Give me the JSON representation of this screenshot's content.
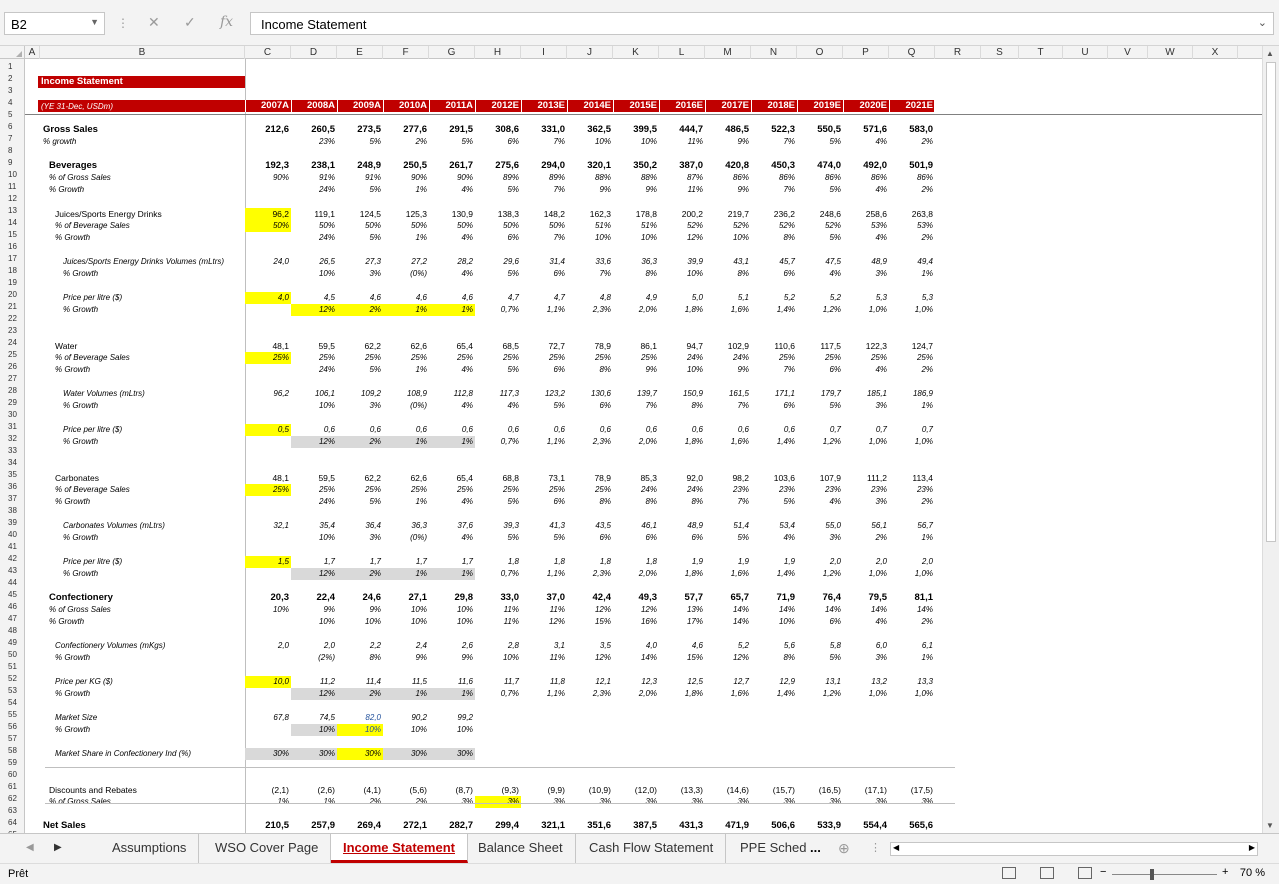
{
  "namebox": "B2",
  "formula": "Income Statement",
  "columns": [
    "A",
    "B",
    "C",
    "D",
    "E",
    "F",
    "G",
    "H",
    "I",
    "J",
    "K",
    "L",
    "M",
    "N",
    "O",
    "P",
    "Q",
    "R",
    "S",
    "T",
    "U",
    "V",
    "W",
    "X"
  ],
  "title": "Income Statement",
  "subtitle": "(YE 31-Dec, USDm)",
  "years": [
    "2007A",
    "2008A",
    "2009A",
    "2010A",
    "2011A",
    "2012E",
    "2013E",
    "2014E",
    "2015E",
    "2016E",
    "2017E",
    "2018E",
    "2019E",
    "2020E",
    "2021E"
  ],
  "rows": [
    {
      "r": 6,
      "label": "Gross Sales",
      "style": "bold",
      "vals": [
        "212,6",
        "260,5",
        "273,5",
        "277,6",
        "291,5",
        "308,6",
        "331,0",
        "362,5",
        "399,5",
        "444,7",
        "486,5",
        "522,3",
        "550,5",
        "571,6",
        "583,0"
      ]
    },
    {
      "r": 7,
      "label": "% growth",
      "style": "ital",
      "vals": [
        "",
        "23%",
        "5%",
        "2%",
        "5%",
        "6%",
        "7%",
        "10%",
        "10%",
        "11%",
        "9%",
        "7%",
        "5%",
        "4%",
        "2%"
      ]
    },
    {
      "r": 9,
      "label": "Beverages",
      "style": "bold",
      "indent": 1,
      "vals": [
        "192,3",
        "238,1",
        "248,9",
        "250,5",
        "261,7",
        "275,6",
        "294,0",
        "320,1",
        "350,2",
        "387,0",
        "420,8",
        "450,3",
        "474,0",
        "492,0",
        "501,9"
      ]
    },
    {
      "r": 10,
      "label": "% of Gross Sales",
      "style": "ital",
      "indent": 1,
      "vals": [
        "90%",
        "91%",
        "91%",
        "90%",
        "90%",
        "89%",
        "89%",
        "88%",
        "88%",
        "87%",
        "86%",
        "86%",
        "86%",
        "86%",
        "86%"
      ]
    },
    {
      "r": 11,
      "label": "% Growth",
      "style": "ital",
      "indent": 1,
      "vals": [
        "",
        "24%",
        "5%",
        "1%",
        "4%",
        "5%",
        "7%",
        "9%",
        "9%",
        "11%",
        "9%",
        "7%",
        "5%",
        "4%",
        "2%"
      ]
    },
    {
      "r": 13,
      "label": "Juices/Sports Energy Drinks",
      "indent": 2,
      "yel": [
        0
      ],
      "vals": [
        "96,2",
        "119,1",
        "124,5",
        "125,3",
        "130,9",
        "138,3",
        "148,2",
        "162,3",
        "178,8",
        "200,2",
        "219,7",
        "236,2",
        "248,6",
        "258,6",
        "263,8"
      ]
    },
    {
      "r": 14,
      "label": "% of Beverage Sales",
      "style": "ital",
      "indent": 2,
      "yel": [
        0
      ],
      "vals": [
        "50%",
        "50%",
        "50%",
        "50%",
        "50%",
        "50%",
        "50%",
        "51%",
        "51%",
        "52%",
        "52%",
        "52%",
        "52%",
        "53%",
        "53%"
      ]
    },
    {
      "r": 15,
      "label": "% Growth",
      "style": "ital",
      "indent": 2,
      "vals": [
        "",
        "24%",
        "5%",
        "1%",
        "4%",
        "6%",
        "7%",
        "10%",
        "10%",
        "12%",
        "10%",
        "8%",
        "5%",
        "4%",
        "2%"
      ]
    },
    {
      "r": 17,
      "label": "Juices/Sports Energy Drinks Volumes (mLtrs)",
      "style": "ital",
      "indent": 3,
      "vals": [
        "24,0",
        "26,5",
        "27,3",
        "27,2",
        "28,2",
        "29,6",
        "31,4",
        "33,6",
        "36,3",
        "39,9",
        "43,1",
        "45,7",
        "47,5",
        "48,9",
        "49,4"
      ]
    },
    {
      "r": 18,
      "label": "% Growth",
      "style": "ital",
      "indent": 3,
      "vals": [
        "",
        "10%",
        "3%",
        "(0%)",
        "4%",
        "5%",
        "6%",
        "7%",
        "8%",
        "10%",
        "8%",
        "6%",
        "4%",
        "3%",
        "1%"
      ]
    },
    {
      "r": 20,
      "label": "Price per litre ($)",
      "style": "ital",
      "indent": 3,
      "yel": [
        0
      ],
      "vals": [
        "4,0",
        "4,5",
        "4,6",
        "4,6",
        "4,6",
        "4,7",
        "4,7",
        "4,8",
        "4,9",
        "5,0",
        "5,1",
        "5,2",
        "5,2",
        "5,3",
        "5,3"
      ]
    },
    {
      "r": 21,
      "label": "% Growth",
      "style": "ital",
      "indent": 3,
      "yel": [
        1,
        2,
        3,
        4
      ],
      "vals": [
        "",
        "12%",
        "2%",
        "1%",
        "1%",
        "0,7%",
        "1,1%",
        "2,3%",
        "2,0%",
        "1,8%",
        "1,6%",
        "1,4%",
        "1,2%",
        "1,0%",
        "1,0%"
      ]
    },
    {
      "r": 24,
      "label": "Water",
      "indent": 2,
      "vals": [
        "48,1",
        "59,5",
        "62,2",
        "62,6",
        "65,4",
        "68,5",
        "72,7",
        "78,9",
        "86,1",
        "94,7",
        "102,9",
        "110,6",
        "117,5",
        "122,3",
        "124,7"
      ]
    },
    {
      "r": 25,
      "label": "% of Beverage Sales",
      "style": "ital",
      "indent": 2,
      "yel": [
        0
      ],
      "vals": [
        "25%",
        "25%",
        "25%",
        "25%",
        "25%",
        "25%",
        "25%",
        "25%",
        "25%",
        "24%",
        "24%",
        "25%",
        "25%",
        "25%",
        "25%"
      ]
    },
    {
      "r": 26,
      "label": "% Growth",
      "style": "ital",
      "indent": 2,
      "vals": [
        "",
        "24%",
        "5%",
        "1%",
        "4%",
        "5%",
        "6%",
        "8%",
        "9%",
        "10%",
        "9%",
        "7%",
        "6%",
        "4%",
        "2%"
      ]
    },
    {
      "r": 28,
      "label": "Water Volumes (mLtrs)",
      "style": "ital",
      "indent": 3,
      "vals": [
        "96,2",
        "106,1",
        "109,2",
        "108,9",
        "112,8",
        "117,3",
        "123,2",
        "130,6",
        "139,7",
        "150,9",
        "161,5",
        "171,1",
        "179,7",
        "185,1",
        "186,9"
      ]
    },
    {
      "r": 29,
      "label": "% Growth",
      "style": "ital",
      "indent": 3,
      "vals": [
        "",
        "10%",
        "3%",
        "(0%)",
        "4%",
        "4%",
        "5%",
        "6%",
        "7%",
        "8%",
        "7%",
        "6%",
        "5%",
        "3%",
        "1%"
      ]
    },
    {
      "r": 31,
      "label": "Price per litre ($)",
      "style": "ital",
      "indent": 3,
      "yel": [
        0
      ],
      "vals": [
        "0,5",
        "0,6",
        "0,6",
        "0,6",
        "0,6",
        "0,6",
        "0,6",
        "0,6",
        "0,6",
        "0,6",
        "0,6",
        "0,6",
        "0,7",
        "0,7",
        "0,7"
      ]
    },
    {
      "r": 32,
      "label": "% Growth",
      "style": "ital",
      "indent": 3,
      "gry": [
        1,
        2,
        3,
        4
      ],
      "vals": [
        "",
        "12%",
        "2%",
        "1%",
        "1%",
        "0,7%",
        "1,1%",
        "2,3%",
        "2,0%",
        "1,8%",
        "1,6%",
        "1,4%",
        "1,2%",
        "1,0%",
        "1,0%"
      ]
    },
    {
      "r": 35,
      "label": "Carbonates",
      "indent": 2,
      "vals": [
        "48,1",
        "59,5",
        "62,2",
        "62,6",
        "65,4",
        "68,8",
        "73,1",
        "78,9",
        "85,3",
        "92,0",
        "98,2",
        "103,6",
        "107,9",
        "111,2",
        "113,4"
      ]
    },
    {
      "r": 36,
      "label": "% of Beverage Sales",
      "style": "ital",
      "indent": 2,
      "yel": [
        0
      ],
      "vals": [
        "25%",
        "25%",
        "25%",
        "25%",
        "25%",
        "25%",
        "25%",
        "25%",
        "24%",
        "24%",
        "23%",
        "23%",
        "23%",
        "23%",
        "23%"
      ]
    },
    {
      "r": 37,
      "label": "% Growth",
      "style": "ital",
      "indent": 2,
      "vals": [
        "",
        "24%",
        "5%",
        "1%",
        "4%",
        "5%",
        "6%",
        "8%",
        "8%",
        "8%",
        "7%",
        "5%",
        "4%",
        "3%",
        "2%"
      ]
    },
    {
      "r": 39,
      "label": "Carbonates Volumes (mLtrs)",
      "style": "ital",
      "indent": 3,
      "vals": [
        "32,1",
        "35,4",
        "36,4",
        "36,3",
        "37,6",
        "39,3",
        "41,3",
        "43,5",
        "46,1",
        "48,9",
        "51,4",
        "53,4",
        "55,0",
        "56,1",
        "56,7"
      ]
    },
    {
      "r": 40,
      "label": "% Growth",
      "style": "ital",
      "indent": 3,
      "vals": [
        "",
        "10%",
        "3%",
        "(0%)",
        "4%",
        "5%",
        "5%",
        "6%",
        "6%",
        "6%",
        "5%",
        "4%",
        "3%",
        "2%",
        "1%"
      ]
    },
    {
      "r": 42,
      "label": "Price per litre ($)",
      "style": "ital",
      "indent": 3,
      "yel": [
        0
      ],
      "vals": [
        "1,5",
        "1,7",
        "1,7",
        "1,7",
        "1,7",
        "1,8",
        "1,8",
        "1,8",
        "1,8",
        "1,9",
        "1,9",
        "1,9",
        "2,0",
        "2,0",
        "2,0"
      ]
    },
    {
      "r": 43,
      "label": "% Growth",
      "style": "ital",
      "indent": 3,
      "gry": [
        1,
        2,
        3,
        4
      ],
      "vals": [
        "",
        "12%",
        "2%",
        "1%",
        "1%",
        "0,7%",
        "1,1%",
        "2,3%",
        "2,0%",
        "1,8%",
        "1,6%",
        "1,4%",
        "1,2%",
        "1,0%",
        "1,0%"
      ]
    },
    {
      "r": 45,
      "label": "Confectionery",
      "style": "bold",
      "indent": 1,
      "vals": [
        "20,3",
        "22,4",
        "24,6",
        "27,1",
        "29,8",
        "33,0",
        "37,0",
        "42,4",
        "49,3",
        "57,7",
        "65,7",
        "71,9",
        "76,4",
        "79,5",
        "81,1"
      ]
    },
    {
      "r": 46,
      "label": "% of Gross Sales",
      "style": "ital",
      "indent": 1,
      "vals": [
        "10%",
        "9%",
        "9%",
        "10%",
        "10%",
        "11%",
        "11%",
        "12%",
        "12%",
        "13%",
        "14%",
        "14%",
        "14%",
        "14%",
        "14%"
      ]
    },
    {
      "r": 47,
      "label": "% Growth",
      "style": "ital",
      "indent": 1,
      "vals": [
        "",
        "10%",
        "10%",
        "10%",
        "10%",
        "11%",
        "12%",
        "15%",
        "16%",
        "17%",
        "14%",
        "10%",
        "6%",
        "4%",
        "2%"
      ]
    },
    {
      "r": 49,
      "label": "Confectionery Volumes (mKgs)",
      "style": "ital",
      "indent": 2,
      "vals": [
        "2,0",
        "2,0",
        "2,2",
        "2,4",
        "2,6",
        "2,8",
        "3,1",
        "3,5",
        "4,0",
        "4,6",
        "5,2",
        "5,6",
        "5,8",
        "6,0",
        "6,1"
      ]
    },
    {
      "r": 50,
      "label": "% Growth",
      "style": "ital",
      "indent": 2,
      "vals": [
        "",
        "(2%)",
        "8%",
        "9%",
        "9%",
        "10%",
        "11%",
        "12%",
        "14%",
        "15%",
        "12%",
        "8%",
        "5%",
        "3%",
        "1%"
      ]
    },
    {
      "r": 52,
      "label": "Price per KG ($)",
      "style": "ital",
      "indent": 2,
      "yel": [
        0
      ],
      "vals": [
        "10,0",
        "11,2",
        "11,4",
        "11,5",
        "11,6",
        "11,7",
        "11,8",
        "12,1",
        "12,3",
        "12,5",
        "12,7",
        "12,9",
        "13,1",
        "13,2",
        "13,3"
      ]
    },
    {
      "r": 53,
      "label": "% Growth",
      "style": "ital",
      "indent": 2,
      "gry": [
        1,
        2,
        3,
        4
      ],
      "vals": [
        "",
        "12%",
        "2%",
        "1%",
        "1%",
        "0,7%",
        "1,1%",
        "2,3%",
        "2,0%",
        "1,8%",
        "1,6%",
        "1,4%",
        "1,2%",
        "1,0%",
        "1,0%"
      ]
    },
    {
      "r": 55,
      "label": "Market Size",
      "style": "ital",
      "indent": 2,
      "vals": [
        "67,8",
        "74,5",
        "82,0",
        "90,2",
        "99,2",
        "",
        "",
        "",
        "",
        "",
        "",
        "",
        "",
        "",
        ""
      ]
    },
    {
      "r": 56,
      "label": "% Growth",
      "style": "ital",
      "indent": 2,
      "gry": [
        1
      ],
      "yel": [
        2
      ],
      "vals": [
        "",
        "10%",
        "10%",
        "10%",
        "10%",
        "",
        "",
        "",
        "",
        "",
        "",
        "",
        "",
        "",
        ""
      ]
    },
    {
      "r": 58,
      "label": "Market Share in Confectionery Ind (%)",
      "style": "ital",
      "indent": 2,
      "gry": [
        0,
        1,
        3,
        4
      ],
      "yel": [
        2
      ],
      "vals": [
        "30%",
        "30%",
        "30%",
        "30%",
        "30%",
        "",
        "",
        "",
        "",
        "",
        "",
        "",
        "",
        "",
        ""
      ]
    },
    {
      "r": 61,
      "label": "Discounts and Rebates",
      "indent": 1,
      "vals": [
        "(2,1)",
        "(2,6)",
        "(4,1)",
        "(5,6)",
        "(8,7)",
        "(9,3)",
        "(9,9)",
        "(10,9)",
        "(12,0)",
        "(13,3)",
        "(14,6)",
        "(15,7)",
        "(16,5)",
        "(17,1)",
        "(17,5)"
      ]
    },
    {
      "r": 62,
      "label": "% of Gross Sales",
      "style": "ital",
      "indent": 1,
      "yel": [
        5
      ],
      "vals": [
        "1%",
        "1%",
        "2%",
        "2%",
        "3%",
        "3%",
        "3%",
        "3%",
        "3%",
        "3%",
        "3%",
        "3%",
        "3%",
        "3%",
        "3%"
      ]
    },
    {
      "r": 64,
      "label": "Net Sales",
      "style": "bold",
      "vals": [
        "210,5",
        "257,9",
        "269,4",
        "272,1",
        "282,7",
        "299,4",
        "321,1",
        "351,6",
        "387,5",
        "431,3",
        "471,9",
        "506,6",
        "533,9",
        "554,4",
        "565,6"
      ]
    },
    {
      "r": 65,
      "label": "% Growth",
      "style": "ital",
      "vals": [
        "",
        "22%",
        "4%",
        "1%",
        "4%",
        "6%",
        "7%",
        "10%",
        "10%",
        "11%",
        "9%",
        "7%",
        "5%",
        "4%",
        "2%"
      ]
    }
  ],
  "tabs": [
    "Assumptions",
    "WSO Cover Page",
    "Income Statement",
    "Balance Sheet",
    "Cash Flow Statement",
    "PPE Sched"
  ],
  "active_tab": "Income Statement",
  "more_tabs": "...",
  "status": "Prêt",
  "zoom": "70 %"
}
